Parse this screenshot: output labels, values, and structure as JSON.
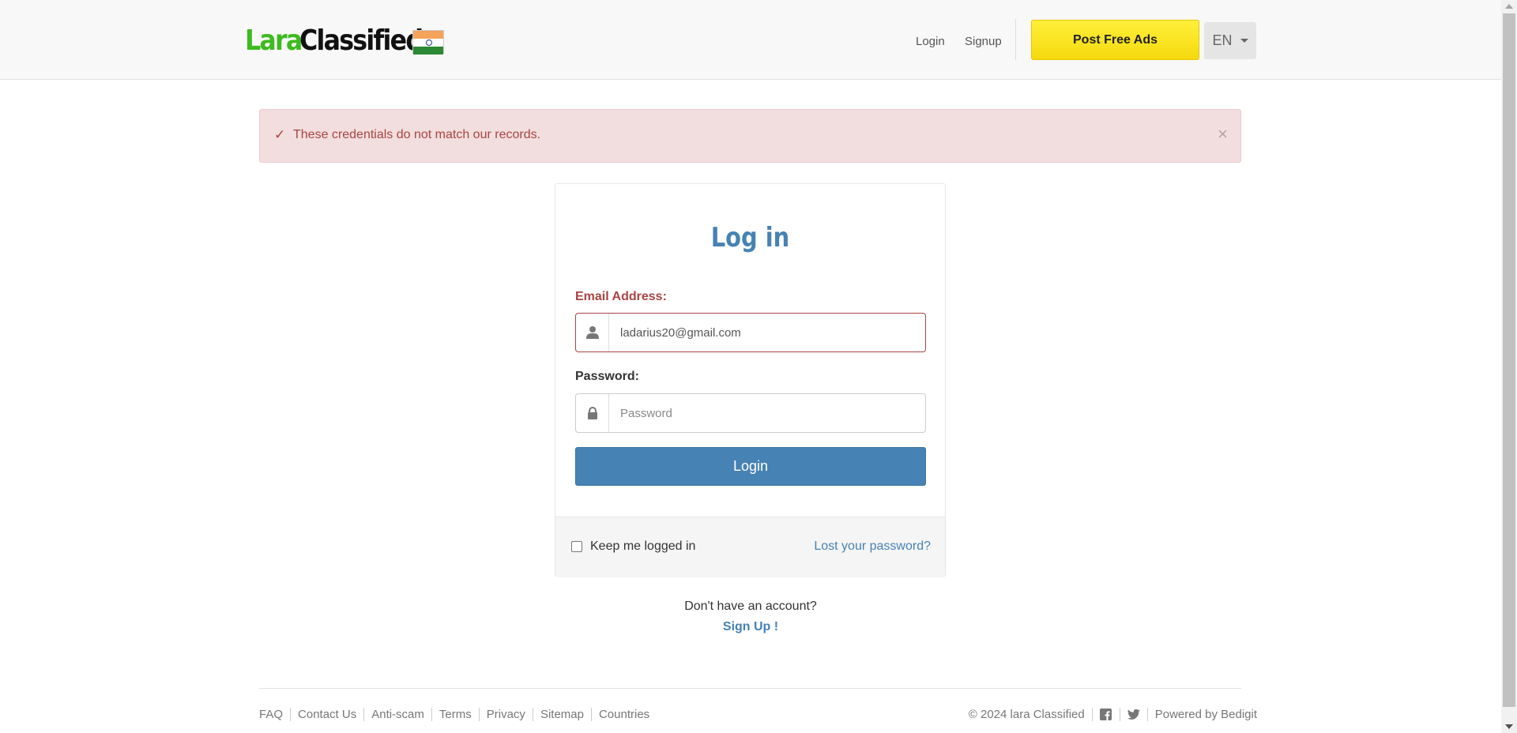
{
  "header": {
    "logo": {
      "part1": "Lara",
      "part2": "Classified"
    },
    "flag_icon": "india-flag-icon",
    "nav": {
      "login": "Login",
      "signup": "Signup"
    },
    "post_ads": "Post Free Ads",
    "language": "EN"
  },
  "alert": {
    "icon": "checkmark-icon",
    "message": "These credentials do not match our records.",
    "close": "×"
  },
  "login_panel": {
    "title": "Log in",
    "email_label": "Email Address:",
    "email_value": "ladarius20@gmail.com",
    "email_icon": "user-icon",
    "password_label": "Password:",
    "password_placeholder": "Password",
    "password_icon": "lock-icon",
    "submit": "Login",
    "remember": "Keep me logged in",
    "remember_checked": false,
    "lost_password": "Lost your password?"
  },
  "signup_prompt": {
    "text": "Don't have an account?",
    "link": "Sign Up !"
  },
  "footer": {
    "links": [
      "FAQ",
      "Contact Us",
      "Anti-scam",
      "Terms",
      "Privacy",
      "Sitemap",
      "Countries"
    ],
    "copyright": "© 2024 lara Classified",
    "social": [
      "facebook-icon",
      "twitter-icon"
    ],
    "powered_by": "Powered by Bedigit"
  },
  "colors": {
    "brand_green": "#3dbb1f",
    "primary": "#4682b4",
    "post_button": "#ffeb3b",
    "error": "#a94442",
    "alert_bg": "#f2dede"
  }
}
